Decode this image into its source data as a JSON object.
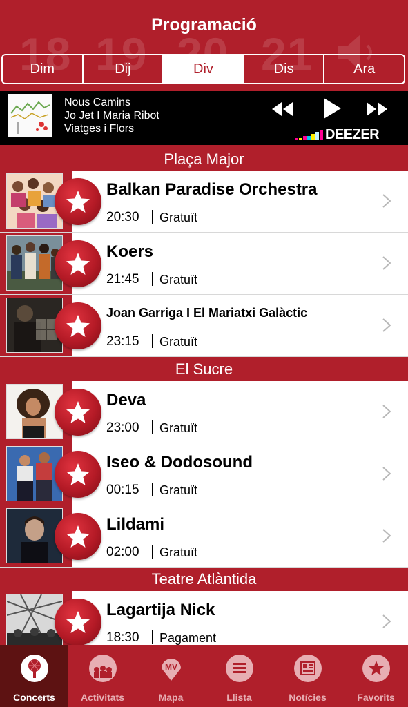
{
  "header": {
    "title": "Programació",
    "bg_dates": [
      "18",
      "19",
      "20",
      "21"
    ],
    "tabs": [
      {
        "label": "Dim",
        "active": false
      },
      {
        "label": "Dij",
        "active": false
      },
      {
        "label": "Div",
        "active": true
      },
      {
        "label": "Dis",
        "active": false
      },
      {
        "label": "Ara",
        "active": false
      }
    ]
  },
  "player": {
    "album": "Nous Camins",
    "artist": "Jo Jet I Maria Ribot",
    "track": "Viatges i Flors",
    "brand": "DEEZER",
    "icons": [
      "rewind-icon",
      "play-icon",
      "fast-forward-icon"
    ]
  },
  "sections": [
    {
      "name": "Plaça Major",
      "concerts": [
        {
          "name": "Balkan Paradise Orchestra",
          "time": "20:30",
          "price": "Gratuït"
        },
        {
          "name": "Koers",
          "time": "21:45",
          "price": "Gratuït"
        },
        {
          "name": "Joan Garriga I El Mariatxi Galàctic",
          "time": "23:15",
          "price": "Gratuït"
        }
      ]
    },
    {
      "name": "El Sucre",
      "concerts": [
        {
          "name": "Deva",
          "time": "23:00",
          "price": "Gratuït"
        },
        {
          "name": "Iseo & Dodosound",
          "time": "00:15",
          "price": "Gratuït"
        },
        {
          "name": "Lildami",
          "time": "02:00",
          "price": "Gratuït"
        }
      ]
    },
    {
      "name": "Teatre Atlàntida",
      "concerts": [
        {
          "name": "Lagartija Nick",
          "time": "18:30",
          "price": "Pagament"
        }
      ]
    }
  ],
  "tabbar": [
    {
      "label": "Concerts",
      "icon": "microphone-icon",
      "active": true
    },
    {
      "label": "Activitats",
      "icon": "audience-icon",
      "active": false
    },
    {
      "label": "Mapa",
      "icon": "map-pin-icon",
      "badge": "MV",
      "active": false
    },
    {
      "label": "Llista",
      "icon": "list-icon",
      "active": false
    },
    {
      "label": "Notícies",
      "icon": "newspaper-icon",
      "active": false
    },
    {
      "label": "Favorits",
      "icon": "star-icon",
      "active": false
    }
  ],
  "colors": {
    "brand_red": "#b01f2b",
    "active_tab_bg": "#5d1212",
    "inactive_label": "#e7aeb3"
  }
}
